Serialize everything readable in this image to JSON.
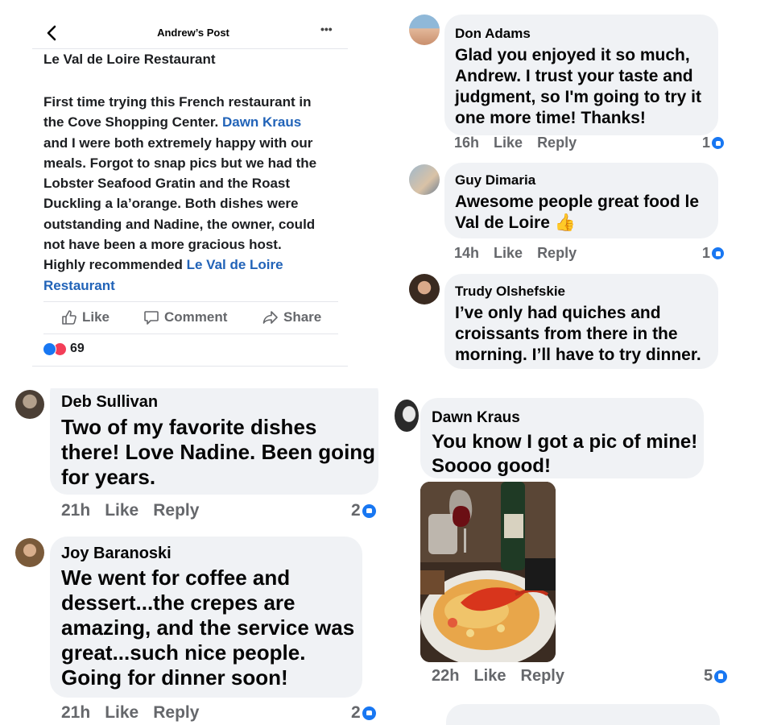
{
  "post": {
    "header_title": "Andrew’s Post",
    "more": "•••",
    "title": "Le Val de Loire Restaurant",
    "body_lines": [
      "First time trying this French restaurant in",
      "the Cove Shopping Center. ",
      "and I were both extremely happy with our",
      "meals. Forgot to snap pics but we had the",
      "Lobster Seafood Gratin and the Roast",
      "Duckling a la’orange. Both dishes were",
      "outstanding and Nadine, the owner, could",
      "not have been a more gracious host.",
      "Highly recommended "
    ],
    "mention_dawn": "Dawn Kraus",
    "mention_place_1": "Le Val de Loire",
    "mention_place_2": "Restaurant",
    "actions": {
      "like": "Like",
      "comment": "Comment",
      "share": "Share"
    },
    "reactions_count": "69"
  },
  "comments_right_top": [
    {
      "name": "Don Adams",
      "text": [
        "Glad you enjoyed it so much,",
        "Andrew. I trust your taste and",
        "judgment, so I'm going to try it",
        "one more time! Thanks!"
      ],
      "time": "16h",
      "like": "Like",
      "reply": "Reply",
      "count": "1"
    },
    {
      "name": "Guy Dimaria",
      "text": [
        "Awesome people great food le",
        "Val de Loire 👍"
      ],
      "time": "14h",
      "like": "Like",
      "reply": "Reply",
      "count": "1"
    },
    {
      "name": "Trudy Olshefskie",
      "text": [
        "I’ve only had quiches and",
        "croissants from there in the",
        "morning. I’ll have to try dinner."
      ]
    }
  ],
  "comments_left_bottom": [
    {
      "name": "Deb Sullivan",
      "text": [
        "Two of my favorite dishes",
        "there! Love Nadine. Been going",
        "for years."
      ],
      "time": "21h",
      "like": "Like",
      "reply": "Reply",
      "count": "2"
    },
    {
      "name": "Joy Baranoski",
      "text": [
        "We went for coffee and",
        "dessert...the crepes are",
        "amazing, and the service was",
        "great...such nice people.",
        "Going for dinner soon!"
      ],
      "time": "21h",
      "like": "Like",
      "reply": "Reply",
      "count": "2"
    }
  ],
  "comment_right_bottom": {
    "name": "Dawn Kraus",
    "text": [
      "You know I got a pic of mine!",
      "Soooo good!"
    ],
    "time": "22h",
    "like": "Like",
    "reply": "Reply",
    "count": "5"
  },
  "colors": {
    "link": "#2163b8",
    "bubble": "#f0f2f5",
    "meta": "#65676b",
    "like_blue": "#1877f2",
    "love_red": "#f33e58"
  },
  "icons": [
    "back-chevron-icon",
    "more-dots-icon",
    "thumbs-up-icon",
    "comment-icon",
    "share-icon",
    "like-reaction-icon",
    "love-reaction-icon"
  ]
}
